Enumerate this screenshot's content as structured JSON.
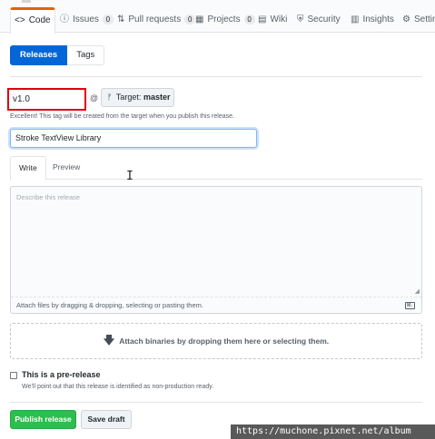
{
  "nav": {
    "tabs": [
      {
        "icon": "<>",
        "label": "Code",
        "count": null
      },
      {
        "icon": "ⓘ",
        "label": "Issues",
        "count": "0"
      },
      {
        "icon": "⇅",
        "label": "Pull requests",
        "count": "0"
      },
      {
        "icon": "▦",
        "label": "Projects",
        "count": "0"
      },
      {
        "icon": "▤",
        "label": "Wiki",
        "count": null
      },
      {
        "icon": "⛨",
        "label": "Security",
        "count": null
      },
      {
        "icon": "▥",
        "label": "Insights",
        "count": null
      },
      {
        "icon": "⚙",
        "label": "Settings",
        "count": null
      }
    ]
  },
  "subnav": {
    "releases": "Releases",
    "tags": "Tags"
  },
  "tag": {
    "value": "v1.0",
    "at": "@",
    "target_prefix": "Target:",
    "target_branch": "master",
    "hint": "Excellent! This tag will be created from the target when you publish this release."
  },
  "release": {
    "title_value": "Stroke TextView Library"
  },
  "editor": {
    "write_tab": "Write",
    "preview_tab": "Preview",
    "placeholder": "Describe this release",
    "attach_text": "Attach files by dragging & dropping, selecting or pasting them."
  },
  "binaries": {
    "text": "Attach binaries by dropping them here or selecting them."
  },
  "prerelease": {
    "label": "This is a pre-release",
    "note": "We’ll point out that this release is identified as non-production ready.",
    "checked": false
  },
  "actions": {
    "publish": "Publish release",
    "draft": "Save draft"
  },
  "watermark": "https://muchone.pixnet.net/album",
  "colors": {
    "accent": "#0366d6",
    "publish": "#2cbe4e",
    "highlight": "#e0000f",
    "selected_tab": "#e36209"
  }
}
